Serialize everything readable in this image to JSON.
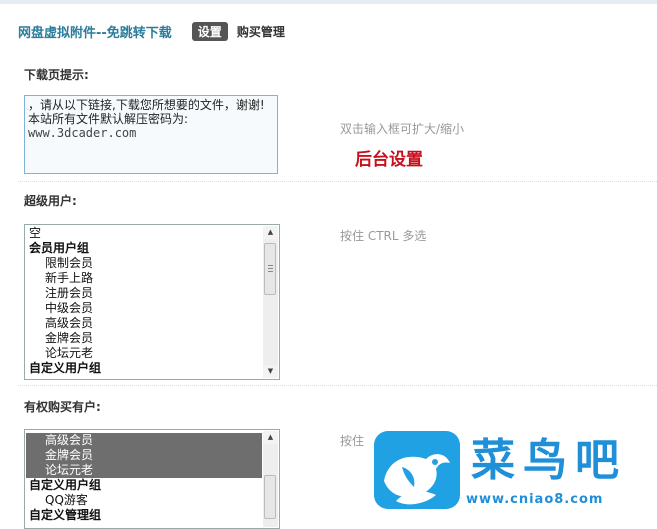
{
  "header": {
    "plugin_title": "网盘虚拟附件--免跳转下载",
    "tabs": [
      {
        "label": "设置",
        "active": true
      },
      {
        "label": "购买管理",
        "active": false
      }
    ]
  },
  "download_tip": {
    "label": "下载页提示:",
    "lines": [
      "，请从以下链接,下载您所想要的文件，谢谢!",
      "本站所有文件默认解压密码为:",
      "www.3dcader.com"
    ],
    "hint": "双击输入框可扩大/缩小",
    "note": "后台设置"
  },
  "super_users": {
    "label": "超级用户:",
    "hint": "按住 CTRL 多选",
    "options": [
      {
        "text": "空",
        "kind": "item"
      },
      {
        "text": "会员用户组",
        "kind": "group"
      },
      {
        "text": "限制会员",
        "kind": "child"
      },
      {
        "text": "新手上路",
        "kind": "child"
      },
      {
        "text": "注册会员",
        "kind": "child"
      },
      {
        "text": "中级会员",
        "kind": "child"
      },
      {
        "text": "高级会员",
        "kind": "child"
      },
      {
        "text": "金牌会员",
        "kind": "child"
      },
      {
        "text": "论坛元老",
        "kind": "child"
      },
      {
        "text": "自定义用户组",
        "kind": "group"
      }
    ]
  },
  "buyers": {
    "label": "有权购买有户:",
    "hint": "按住",
    "options": [
      {
        "text": "高级会员",
        "kind": "child",
        "selected": true
      },
      {
        "text": "金牌会员",
        "kind": "child",
        "selected": true
      },
      {
        "text": "论坛元老",
        "kind": "child",
        "selected": true
      },
      {
        "text": "自定义用户组",
        "kind": "group"
      },
      {
        "text": "QQ游客",
        "kind": "child"
      },
      {
        "text": "自定义管理组",
        "kind": "group"
      }
    ]
  },
  "watermark": {
    "name": "菜鸟吧",
    "url": "www.cniao8.com",
    "icon": "bird-logo-icon"
  },
  "colors": {
    "title": "#2b7d9b",
    "active_tab": "#555555",
    "note": "#c8101c",
    "selected_option": "#6e6e6e",
    "watermark": "#1f8fd8"
  }
}
